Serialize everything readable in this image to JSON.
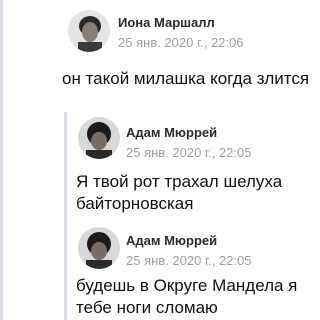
{
  "comments": [
    {
      "author": "Иона Маршалл",
      "timestamp": "25 янв. 2020 г., 22:06",
      "text": "он такой милашка когда злится"
    },
    {
      "author": "Адам Мюррей",
      "timestamp": "25 янв. 2020 г., 22:05",
      "text": "Я твой рот трахал шелуха байторновская"
    },
    {
      "author": "Адам Мюррей",
      "timestamp": "25 янв. 2020 г., 22:05",
      "text": "будешь в Округе Мандела я тебе ноги сломаю"
    }
  ],
  "colors": {
    "author": "#2b2b2b",
    "timestamp": "#9aa0a6",
    "body": "#111111",
    "rule": "#d9dde3"
  }
}
